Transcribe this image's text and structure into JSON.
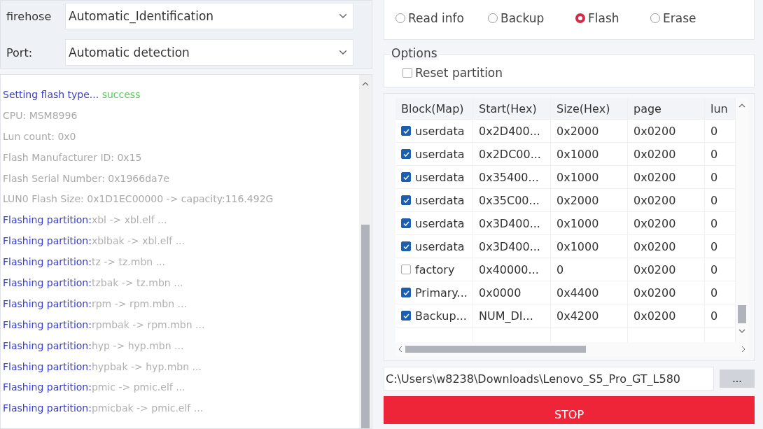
{
  "connection": {
    "fields": [
      {
        "label": "firehose",
        "value": "Automatic_Identification"
      },
      {
        "label": "Port:",
        "value": "Automatic detection"
      }
    ]
  },
  "log": [
    {
      "kind": "status",
      "label": "Setting flash type...",
      "detail": "success"
    },
    {
      "kind": "plain",
      "label": "CPU: MSM8996"
    },
    {
      "kind": "plain",
      "label": "Lun count: 0x0"
    },
    {
      "kind": "plain",
      "label": "Flash Manufacturer ID: 0x15"
    },
    {
      "kind": "plain",
      "label": "Flash Serial Number: 0x1966da7e"
    },
    {
      "kind": "plain",
      "label": "LUN0 Flash Size: 0x1D1EC00000 -> capacity:116.492G"
    },
    {
      "kind": "flash",
      "label": "Flashing partition:",
      "detail": "xbl -> xbl.elf ..."
    },
    {
      "kind": "flash",
      "label": "Flashing partition:",
      "detail": "xblbak -> xbl.elf ..."
    },
    {
      "kind": "flash",
      "label": "Flashing partition:",
      "detail": "tz -> tz.mbn ..."
    },
    {
      "kind": "flash",
      "label": "Flashing partition:",
      "detail": "tzbak -> tz.mbn ..."
    },
    {
      "kind": "flash",
      "label": "Flashing partition:",
      "detail": "rpm -> rpm.mbn ..."
    },
    {
      "kind": "flash",
      "label": "Flashing partition:",
      "detail": "rpmbak -> rpm.mbn ..."
    },
    {
      "kind": "flash",
      "label": "Flashing partition:",
      "detail": "hyp -> hyp.mbn ..."
    },
    {
      "kind": "flash",
      "label": "Flashing partition:",
      "detail": "hypbak -> hyp.mbn ..."
    },
    {
      "kind": "flash",
      "label": "Flashing partition:",
      "detail": "pmic -> pmic.elf ..."
    },
    {
      "kind": "flash",
      "label": "Flashing partition:",
      "detail": "pmicbak -> pmic.elf ..."
    }
  ],
  "function_options": [
    {
      "label": "Read info",
      "selected": false
    },
    {
      "label": "Backup",
      "selected": false
    },
    {
      "label": "Flash",
      "selected": true
    },
    {
      "label": "Erase",
      "selected": false
    }
  ],
  "options": {
    "title": "Options",
    "items": [
      {
        "label": "Reset partition",
        "checked": false
      }
    ]
  },
  "table": {
    "columns": [
      "Block(Map)",
      "Start(Hex)",
      "Size(Hex)",
      "page",
      "lun"
    ],
    "rows": [
      {
        "checked": true,
        "cells": [
          "userdata",
          "0x2D400...",
          "0x2000",
          "0x0200",
          "0"
        ]
      },
      {
        "checked": true,
        "cells": [
          "userdata",
          "0x2DC00...",
          "0x1000",
          "0x0200",
          "0"
        ]
      },
      {
        "checked": true,
        "cells": [
          "userdata",
          "0x35400...",
          "0x1000",
          "0x0200",
          "0"
        ]
      },
      {
        "checked": true,
        "cells": [
          "userdata",
          "0x35C00...",
          "0x2000",
          "0x0200",
          "0"
        ]
      },
      {
        "checked": true,
        "cells": [
          "userdata",
          "0x3D400...",
          "0x1000",
          "0x0200",
          "0"
        ]
      },
      {
        "checked": true,
        "cells": [
          "userdata",
          "0x3D400...",
          "0x1000",
          "0x0200",
          "0"
        ]
      },
      {
        "checked": false,
        "cells": [
          "factory",
          "0x40000...",
          "0",
          "0x0200",
          "0"
        ]
      },
      {
        "checked": true,
        "cells": [
          "Primary...",
          "0x0000",
          "0x4400",
          "0x0200",
          "0"
        ]
      },
      {
        "checked": true,
        "cells": [
          "Backup...",
          "NUM_DI...",
          "0x4200",
          "0x0200",
          "0"
        ]
      }
    ]
  },
  "path": {
    "value": "C:\\Users\\w8238\\Downloads\\Lenovo_S5_Pro_GT_L580",
    "browse_label": "..."
  },
  "stop_button": "STOP"
}
